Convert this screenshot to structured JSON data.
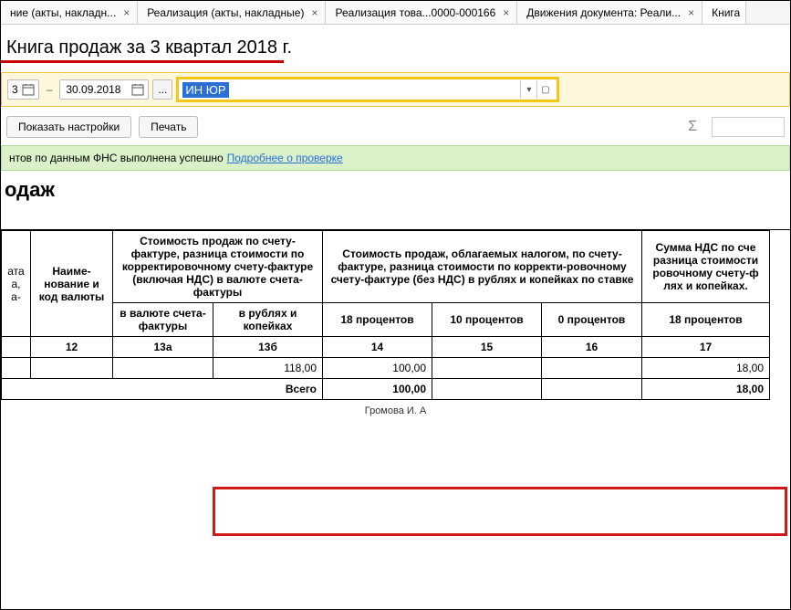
{
  "tabs": [
    {
      "label": "ние (акты, накладн...",
      "active": false
    },
    {
      "label": "Реализация (акты, накладные)",
      "active": false
    },
    {
      "label": "Реализация това...0000-000166",
      "active": false
    },
    {
      "label": "Движения документа: Реали...",
      "active": false
    },
    {
      "label": "Книга",
      "active": true,
      "noclose": true
    }
  ],
  "title": "Книга продаж за 3 квартал 2018 г.",
  "filter": {
    "date_from_trunc": "3",
    "date_to": "30.09.2018",
    "contragent_selected": "ИН ЮР",
    "ellipsis": "..."
  },
  "buttons": {
    "show_settings": "Показать настройки",
    "print": "Печать"
  },
  "greenbar": {
    "text_prefix": "нтов по данным ФНС выполнена успешно",
    "link": "Подробнее о проверке"
  },
  "report_heading": "одаж",
  "table": {
    "group_headers": {
      "col_ata": "ата а, а-",
      "col_name_currency": "Наиме-нование и код валюты",
      "col_cost_invoice": "Стоимость продаж по счету-фактуре, разница стоимости по корректировочному счету-фактуре (включая НДС) в валюте счета-фактуры",
      "col_cost_taxable": "Стоимость продаж, облагаемых налогом, по счету-фактуре, разница стоимости по корректи-ровочному счету-фактуре (без НДС) в рублях и копейках по ставке",
      "col_vat": "Сумма НДС по сче разница стоимости ровочному счету-ф лях и копейках."
    },
    "sub_headers": {
      "h13a": "в валюте счета-фактуры",
      "h13b": "в рублях и копейках",
      "h14": "18 процентов",
      "h15": "10 процентов",
      "h16": "0 процентов",
      "h17": "18 процентов"
    },
    "col_numbers": {
      "c12": "12",
      "c13a": "13а",
      "c13b": "13б",
      "c14": "14",
      "c15": "15",
      "c16": "16",
      "c17": "17"
    },
    "row1": {
      "v13b": "118,00",
      "v14": "100,00",
      "v15": "",
      "v16": "",
      "v17": "18,00"
    },
    "total": {
      "label": "Всего",
      "v14": "100,00",
      "v17": "18,00"
    },
    "footer_name": "Громова И. А"
  },
  "icons": {
    "sigma": "Σ",
    "dropdown": "▾",
    "open": "▢",
    "close": "×",
    "dash": "–"
  }
}
